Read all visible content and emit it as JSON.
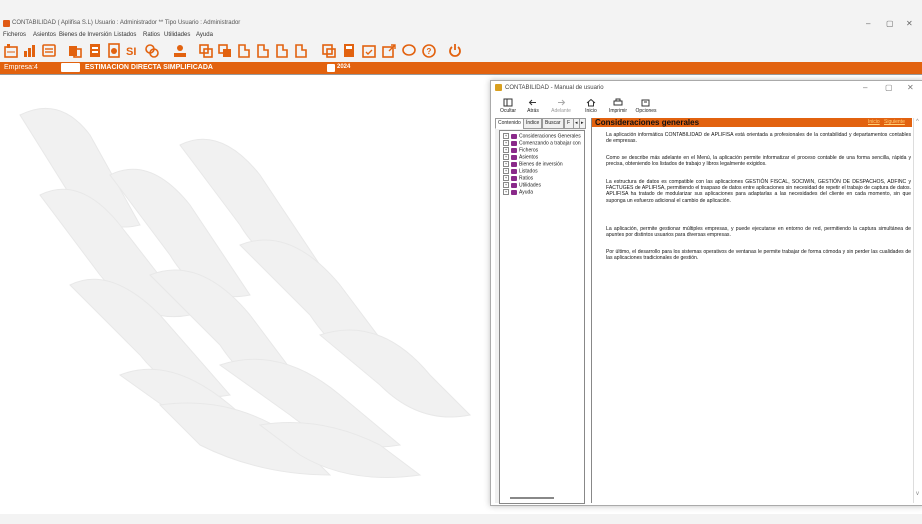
{
  "window": {
    "title": "CONTABILIDAD  ( Aplifisa S.L)  Usuario : Administrador  **  Tipo Usuario : Administrador",
    "controls": [
      "–",
      "▢",
      "✕"
    ]
  },
  "menu": [
    "Ficheros",
    "Asientos",
    "Bienes de Inversión",
    "Listados",
    "Ratios",
    "Utilidades",
    "Ayuda"
  ],
  "toolbar_icons": [
    "ledger-icon",
    "chart-icon",
    "screen-icon",
    "stamp-icon",
    "doc-icon",
    "bank-icon",
    "si-icon",
    "coins-icon",
    "person-icon",
    "cards-icon",
    "stack-icon",
    "report1-icon",
    "report2-icon",
    "report3-icon",
    "report4-icon",
    "folders-icon",
    "calc-icon",
    "calendar-icon",
    "export-icon",
    "chat-icon",
    "help-icon",
    "power-icon"
  ],
  "empresa": {
    "label": "Empresa:",
    "number": "4",
    "mode": "ESTIMACION DIRECTA SIMPLIFICADA",
    "year": "2024"
  },
  "help": {
    "title": "CONTABILIDAD - Manual de usuario",
    "toolbar": [
      "Ocultar",
      "Atrás",
      "Adelante",
      "Inicio",
      "Imprimir",
      "Opciones"
    ],
    "tabs": [
      "Contenido",
      "Índice",
      "Buscar",
      "F"
    ],
    "tree": [
      "Consideraciones Generales",
      "Comenzando a trabajar con",
      "Ficheros",
      "Asientos",
      "Bienes de inversión",
      "Listados",
      "Ratios",
      "Utilidades",
      "Ayuda"
    ],
    "heading": "Consideraciones generales",
    "nav_prev": "Inicio",
    "nav_next": "Siguiente",
    "paragraphs": [
      "La aplicación informática CONTABILIDAD de APLIFISA está orientada a profesionales de la contabilidad y departamentos contables de empresas.",
      "Como se describe más adelante en el Menú, la aplicación permite informatizar el proceso contable de una forma sencilla, rápida y precisa, obteniendo los listados de trabajo y libros legalmente exigidos.",
      "La estructura de datos es compatible con las aplicaciones GESTIÓN FISCAL, SOCIWIN, GESTIÓN DE DESPACHOS, ADFINC y FACTUGES de APLIFISA, permitiendo el traspaso de datos entre aplicaciones sin necesidad de repetir el trabajo de captura de datos. APLIFISA ha tratado de modularizar sus aplicaciones para adaptarlas a las necesidades del cliente en cada momento, sin que suponga un esfuerzo adicional el cambio de aplicación.",
      "La aplicación, permite gestionar múltiples empresas, y puede ejecutarse en entorno de red, permitiendo la captura simultánea de apuntes por distintos usuarios para diversas empresas.",
      "Por último, el desarrollo para los sistemas operativos de ventanas le permite trabajar de forma cómoda y sin perder las cualidades de las aplicaciones tradicionales de gestión."
    ]
  },
  "colors": {
    "accent": "#e2620f",
    "toolbar_icon": "#e2620f"
  }
}
